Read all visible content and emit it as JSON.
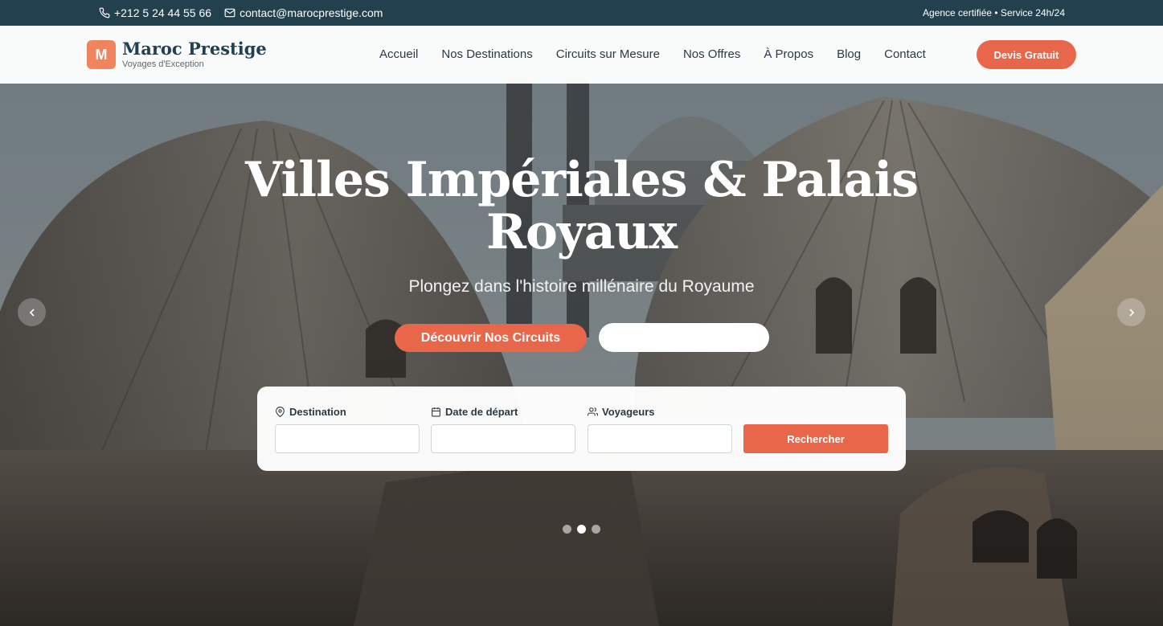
{
  "topbar": {
    "phone": "+212 5 24 44 55 66",
    "email": "contact@marocprestige.com",
    "tagline": "Agence certifiée • Service 24h/24"
  },
  "header": {
    "logo_letter": "M",
    "brand_name": "Maroc Prestige",
    "brand_tagline": "Voyages d'Exception",
    "nav": [
      "Accueil",
      "Nos Destinations",
      "Circuits sur Mesure",
      "Nos Offres",
      "À Propos",
      "Blog",
      "Contact"
    ],
    "cta": "Devis Gratuit"
  },
  "hero": {
    "title_line1": "Villes Impériales & Palais",
    "title_line2": "Royaux",
    "subtitle": "Plongez dans l'histoire millénaire du Royaume",
    "primary_button": "Découvrir Nos Circuits",
    "secondary_button": "",
    "prev_icon": "chevron-left-icon",
    "next_icon": "chevron-right-icon",
    "slides_count": 3,
    "active_slide": 2
  },
  "search": {
    "destination_label": "Destination",
    "date_label": "Date de départ",
    "travelers_label": "Voyageurs",
    "destination_value": "",
    "date_value": "",
    "travelers_value": "",
    "submit": "Rechercher"
  },
  "colors": {
    "accent": "#e8664a",
    "topbar": "#23404f",
    "logo": "#f0845f"
  }
}
